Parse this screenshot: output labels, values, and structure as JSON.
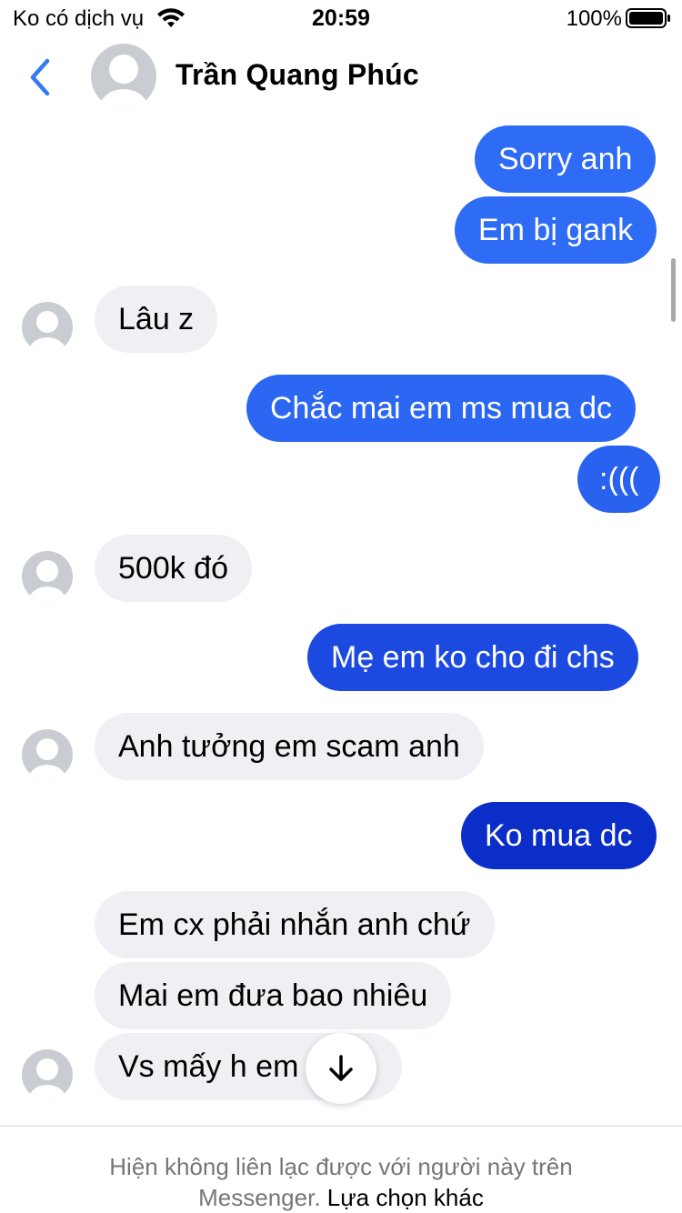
{
  "status_bar": {
    "carrier": "Ko có dịch vụ",
    "time": "20:59",
    "battery": "100%"
  },
  "header": {
    "contact_name": "Trần Quang Phúc",
    "accent_color": "#3478f6"
  },
  "messages": [
    {
      "direction": "out",
      "text": "Sorry anh"
    },
    {
      "direction": "out",
      "text": "Em bị gank"
    },
    {
      "direction": "in",
      "text": "Lâu z"
    },
    {
      "direction": "out",
      "text": "Chắc mai em ms mua dc"
    },
    {
      "direction": "out",
      "text": ":((("
    },
    {
      "direction": "in",
      "text": "500k đó"
    },
    {
      "direction": "out",
      "text": "Mẹ em ko cho đi chs"
    },
    {
      "direction": "in",
      "text": "Anh tưởng em scam anh"
    },
    {
      "direction": "out",
      "text": "Ko mua dc"
    },
    {
      "direction": "in",
      "text": "Em cx phải nhắn anh chứ"
    },
    {
      "direction": "in",
      "text": "Mai em đưa bao nhiêu"
    },
    {
      "direction": "in",
      "text": "Vs mấy h em"
    }
  ],
  "footer": {
    "notice": "Hiện không liên lạc được với người này trên",
    "notice_line2": "Messenger.",
    "link_label": "Lựa chọn khác"
  },
  "colors": {
    "bubble_out_top": "#2f6cf6",
    "bubble_out_bottom": "#0b2ec8",
    "bubble_in": "#eef0f3"
  }
}
